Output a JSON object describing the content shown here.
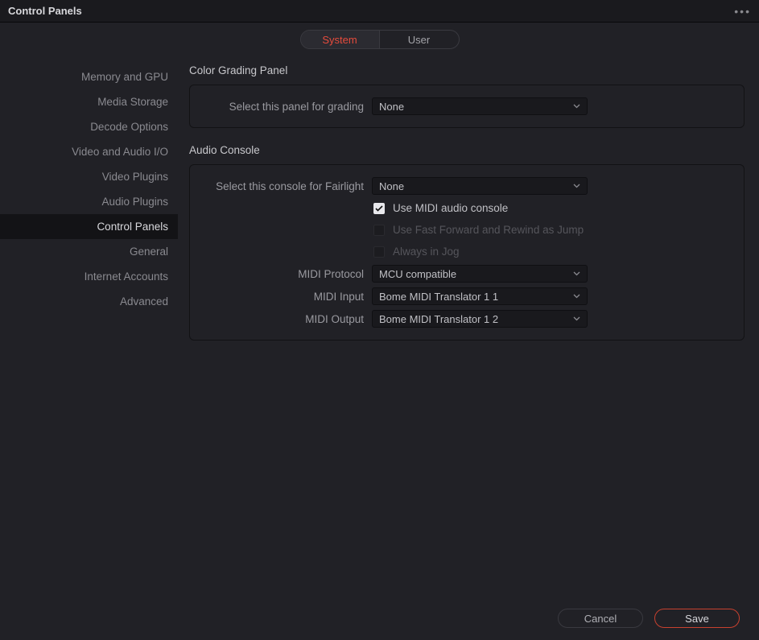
{
  "window": {
    "title": "Control Panels"
  },
  "tabs": {
    "system": "System",
    "user": "User",
    "active": "system"
  },
  "sidebar": {
    "items": [
      "Memory and GPU",
      "Media Storage",
      "Decode Options",
      "Video and Audio I/O",
      "Video Plugins",
      "Audio Plugins",
      "Control Panels",
      "General",
      "Internet Accounts",
      "Advanced"
    ],
    "active_index": 6
  },
  "sections": {
    "color_grading": {
      "title": "Color Grading Panel",
      "select_label": "Select this panel for grading",
      "select_value": "None"
    },
    "audio_console": {
      "title": "Audio Console",
      "select_label": "Select this console for Fairlight",
      "select_value": "None",
      "checkboxes": {
        "use_midi": {
          "label": "Use MIDI audio console",
          "checked": true,
          "disabled": false
        },
        "ff_rewind": {
          "label": "Use Fast Forward and Rewind as Jump",
          "checked": false,
          "disabled": true
        },
        "always_jog": {
          "label": "Always in Jog",
          "checked": false,
          "disabled": true
        }
      },
      "midi_protocol": {
        "label": "MIDI Protocol",
        "value": "MCU compatible"
      },
      "midi_input": {
        "label": "MIDI Input",
        "value": "Bome MIDI Translator 1 1"
      },
      "midi_output": {
        "label": "MIDI Output",
        "value": "Bome MIDI Translator 1 2"
      }
    }
  },
  "footer": {
    "cancel": "Cancel",
    "save": "Save"
  }
}
